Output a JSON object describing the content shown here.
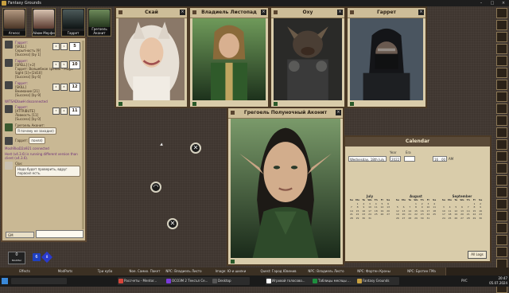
{
  "window": {
    "title": "Fantasy Grounds"
  },
  "party": [
    {
      "name": "Агнесс",
      "color": "#6a4e3c"
    },
    {
      "name": "Айюм Мерфи",
      "color": "#8a6b5a"
    },
    {
      "name": "Гаррет",
      "color": "#2a3a3a"
    },
    {
      "name": "Грегоель Аконит",
      "color": "#2f4a2a"
    }
  ],
  "chat": {
    "messages": [
      {
        "who": "Гаррет:",
        "lines": [
          "[SKILL]",
          "Скрытность [9]",
          "[Success] [by 1]"
        ],
        "dice": [
          "4",
          "1"
        ],
        "total": "5"
      },
      {
        "who": "Гаррет:",
        "lines": [
          "[SPELL] [+2]",
          "Гаррет: Волшебное зрение - Magic",
          "Sight [1]+[2d10]",
          "[Success] [by 6]"
        ],
        "dice": [
          "5",
          "5"
        ],
        "total": "10"
      },
      {
        "who": "Гаррет:",
        "lines": [
          "[SKILL]",
          "Внимание [21]",
          "[Success] [by 9]"
        ],
        "dice": [
          "4",
          "8"
        ],
        "total": "12"
      },
      {
        "who": "Гаррет:",
        "lines": [
          "[ATTRIBUTE]",
          "Ловкость [11]",
          "[Success] [by 0]"
        ],
        "dice": [
          "7",
          "4"
        ],
        "total": "11"
      }
    ],
    "system1": "WITSADlawH disconnected",
    "talk1_name": "Грегоель Аконит:",
    "talk1_text": "Я почему не заходил)",
    "talk2_name": "Гаррет:",
    "talk2_text": "понял)",
    "system2": "MoshRkoD2a921 connected",
    "system3": "Host (v4.3.6) is running different version than client (v4.3.6).",
    "talk3_name": "Ckи:",
    "talk3_text": "Надо будет проверить, вдруг порасил есть.",
    "mode": "GM"
  },
  "dice_tray": {
    "count": "0",
    "label": "Modifier",
    "d6": "6",
    "d8": "8"
  },
  "portraits": [
    {
      "title": "Скай",
      "bg1": "#d8d0c4",
      "bg2": "#7a6a5a"
    },
    {
      "title": "Владиель Листопад",
      "bg1": "#4d7a4a",
      "bg2": "#1f3a20"
    },
    {
      "title": "Оху",
      "bg1": "#3a3a38",
      "bg2": "#141414"
    },
    {
      "title": "Гаррет",
      "bg1": "#5a6468",
      "bg2": "#1a1c1f"
    },
    {
      "title": "Грегоель Полуночный Аконит",
      "bg1": "#5f7a5a",
      "bg2": "#1a2a1a"
    }
  ],
  "calendar": {
    "title": "Calendar",
    "date_label": "Wednesday, 18th July",
    "year": "2022",
    "era": "",
    "time": "16 : 00",
    "am_pm": "AM",
    "col_year": "Year",
    "col_era": "Era",
    "months": [
      {
        "name": "July",
        "days": [
          "Su",
          "Mo",
          "Tu",
          "We",
          "Th",
          "Fr",
          "Sa",
          "",
          "1",
          "2",
          "3",
          "4",
          "5",
          "6",
          "7",
          "8",
          "9",
          "10",
          "11",
          "12",
          "13",
          "14",
          "15",
          "16",
          "17",
          "18",
          "19",
          "20",
          "21",
          "22",
          "23",
          "24",
          "25",
          "26",
          "27",
          "28",
          "29",
          "30",
          "31"
        ]
      },
      {
        "name": "August",
        "days": [
          "Su",
          "Mo",
          "Tu",
          "We",
          "Th",
          "Fr",
          "Sa",
          "",
          "",
          "",
          "1",
          "2",
          "3",
          "4",
          "5",
          "6",
          "7",
          "8",
          "9",
          "10",
          "11",
          "12",
          "13",
          "14",
          "15",
          "16",
          "17",
          "18",
          "19",
          "20",
          "21",
          "22",
          "23",
          "24",
          "25",
          "26",
          "27",
          "28",
          "29",
          "30",
          "31"
        ]
      },
      {
        "name": "September",
        "days": [
          "Su",
          "Mo",
          "Tu",
          "We",
          "Th",
          "Fr",
          "Sa",
          "",
          "",
          "",
          "",
          "",
          "1",
          "2",
          "3",
          "4",
          "5",
          "6",
          "7",
          "8",
          "9",
          "10",
          "11",
          "12",
          "13",
          "14",
          "15",
          "16",
          "17",
          "18",
          "19",
          "20",
          "21",
          "22",
          "23",
          "24",
          "25",
          "26",
          "27",
          "28",
          "29",
          "30"
        ]
      }
    ],
    "all_logs": "All Logs"
  },
  "tabs": [
    "Effects",
    "ModParts",
    "Три куба",
    "Noe. Самих. Пакет",
    "NPC: Владиель Листо",
    "Image: Ю-и шилки",
    "Quest: Гарод Ювенив",
    "NPC: Владиель Листо",
    "NPC: Фортен Кроны",
    "NPC: Бротин ГМа"
  ],
  "taskbar": {
    "items": [
      {
        "label": "Рассчеты - Mentor...",
        "color": "#d6453a"
      },
      {
        "label": "ОСОЗМ 2 Тексъл Се...",
        "color": "#7a3adb"
      },
      {
        "label": "Desktop",
        "color": "#555555"
      },
      {
        "label": "Игровой голосово...",
        "color": "#ffffff"
      },
      {
        "label": "Таблицы месяцы ...",
        "color": "#1e8e3e"
      },
      {
        "label": "Fantasy Grounds",
        "color": "#c8a040"
      }
    ],
    "lang": "РУС",
    "time": "20:47",
    "date": "05.07.2024"
  }
}
